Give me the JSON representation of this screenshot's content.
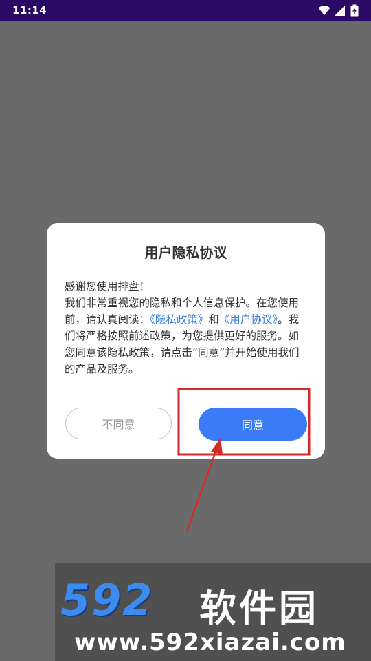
{
  "status_bar": {
    "time": "11:14",
    "icons": [
      "wifi-icon",
      "signal-icon",
      "battery-charging-icon"
    ]
  },
  "dialog": {
    "title": "用户隐私协议",
    "greeting": "感谢您使用排盘！",
    "body_part1": "我们非常重视您的隐私和个人信息保护。在您使用前，请认真阅读：",
    "privacy_link": "《隐私政策》",
    "conjunction": "和",
    "user_agreement_link": "《用户协议》",
    "body_part2": "。我们将严格按照前述政策，为您提供更好的服务。如您同意该隐私政策，请点击“同意”并开始使用我们的产品及服务。",
    "disagree_label": "不同意",
    "agree_label": "同意"
  },
  "colors": {
    "overlay": "#6a6a6a",
    "status_bar": "#2b0a66",
    "link": "#3d7fe6",
    "primary_button": "#3b7bf6",
    "annotation": "#d42a2a"
  },
  "watermark": {
    "logo": "592",
    "name": "软件园",
    "url": "www.592xiazai.com"
  }
}
